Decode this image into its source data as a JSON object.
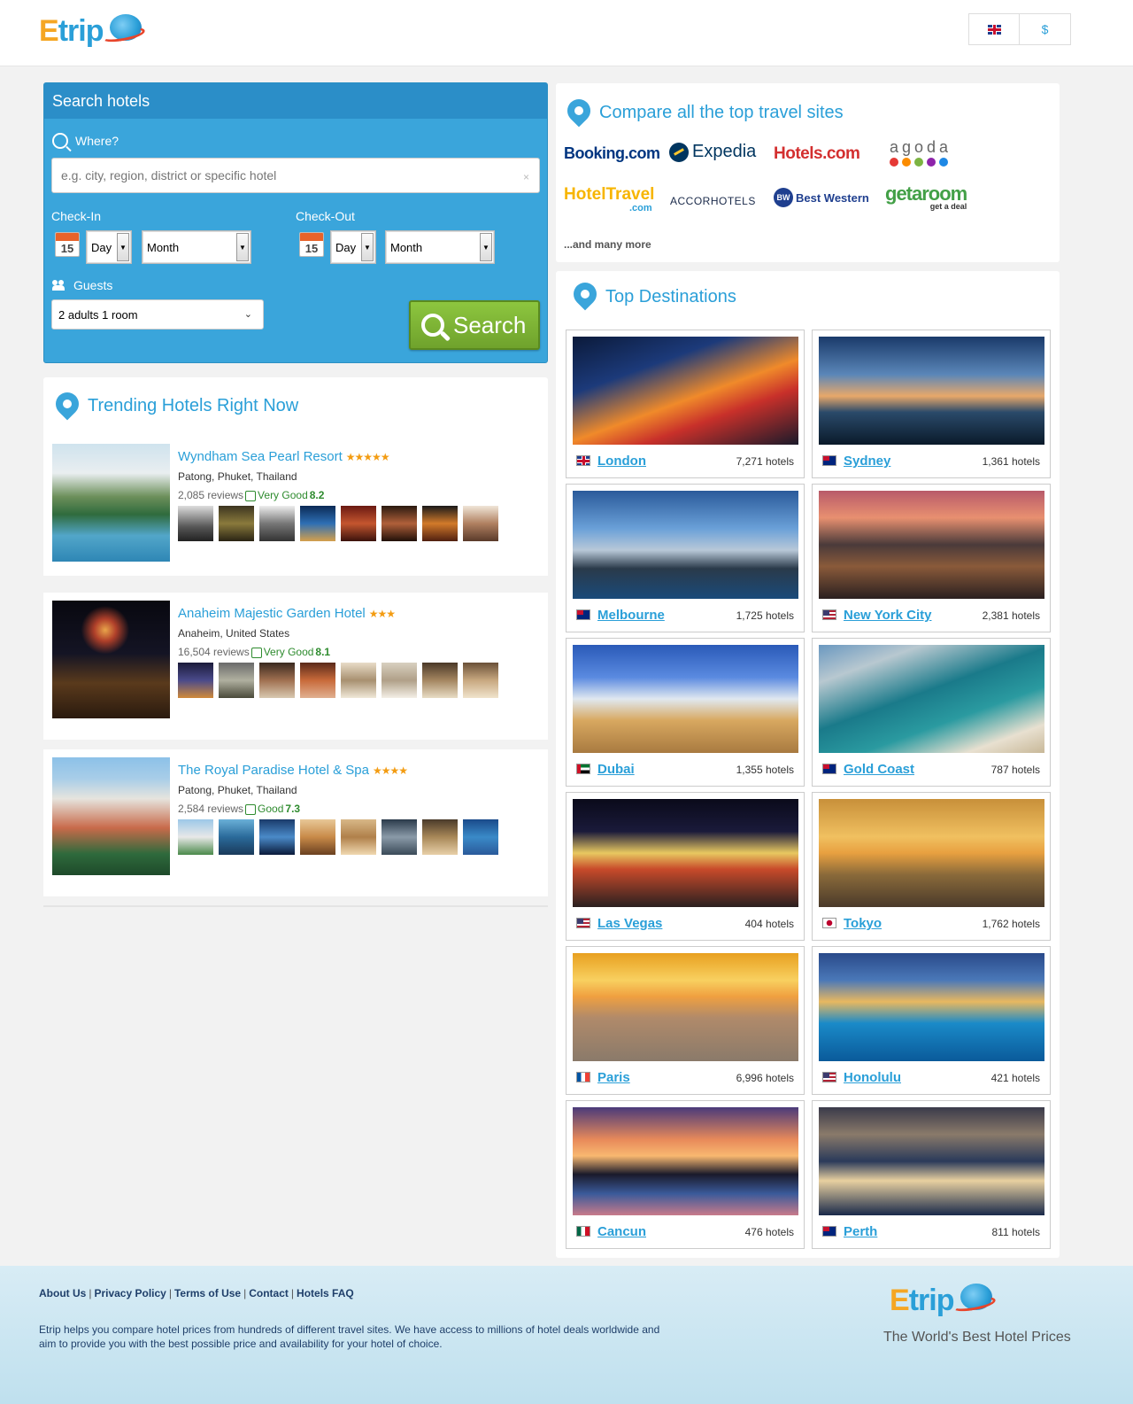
{
  "header": {
    "logo_text_e": "E",
    "logo_text_rest": "trip",
    "language_flag": "uk-flag-icon",
    "currency_label": "$"
  },
  "search": {
    "title": "Search hotels",
    "where_label": "Where?",
    "where_placeholder": "e.g. city, region, district or specific hotel",
    "clear_label": "×",
    "checkin_label": "Check-In",
    "checkout_label": "Check-Out",
    "calendar_day": "15",
    "day_label": "Day",
    "month_label": "Month",
    "guests_label": "Guests",
    "guests_value": "2 adults 1 room",
    "search_button": "Search"
  },
  "trending": {
    "title": "Trending Hotels Right Now",
    "hotels": [
      {
        "name": "Wyndham Sea Pearl Resort",
        "stars": "★★★★★",
        "location": "Patong, Phuket, Thailand",
        "reviews": "2,085 reviews",
        "rating_text": "Very Good",
        "rating_score": "8.2"
      },
      {
        "name": "Anaheim Majestic Garden Hotel",
        "stars": "★★★",
        "location": "Anaheim, United States",
        "reviews": "16,504 reviews",
        "rating_text": "Very Good",
        "rating_score": "8.1"
      },
      {
        "name": "The Royal Paradise Hotel & Spa",
        "stars": "★★★★",
        "location": "Patong, Phuket, Thailand",
        "reviews": "2,584 reviews",
        "rating_text": "Good",
        "rating_score": "7.3"
      }
    ]
  },
  "compare": {
    "title": "Compare all the top travel sites",
    "brands": [
      "Booking.com",
      "Expedia",
      "Hotels.com",
      "agoda",
      "HotelTravel",
      ".com",
      "ACCORHOTELS",
      "Best Western",
      "getaroom",
      "get a deal"
    ],
    "more": "...and many more"
  },
  "destinations": {
    "title": "Top Destinations",
    "items": [
      {
        "city": "London",
        "count": "7,271 hotels",
        "flag": "uk-flag-icon"
      },
      {
        "city": "Sydney",
        "count": "1,361 hotels",
        "flag": "australia-flag-icon"
      },
      {
        "city": "Melbourne",
        "count": "1,725 hotels",
        "flag": "australia-flag-icon"
      },
      {
        "city": "New York City",
        "count": "2,381 hotels",
        "flag": "usa-flag-icon"
      },
      {
        "city": "Dubai",
        "count": "1,355 hotels",
        "flag": "uae-flag-icon"
      },
      {
        "city": "Gold Coast",
        "count": "787 hotels",
        "flag": "australia-flag-icon"
      },
      {
        "city": "Las Vegas",
        "count": "404 hotels",
        "flag": "usa-flag-icon"
      },
      {
        "city": "Tokyo",
        "count": "1,762 hotels",
        "flag": "japan-flag-icon"
      },
      {
        "city": "Paris",
        "count": "6,996 hotels",
        "flag": "france-flag-icon"
      },
      {
        "city": "Honolulu",
        "count": "421 hotels",
        "flag": "usa-flag-icon"
      },
      {
        "city": "Cancun",
        "count": "476 hotels",
        "flag": "mexico-flag-icon"
      },
      {
        "city": "Perth",
        "count": "811 hotels",
        "flag": "australia-flag-icon"
      }
    ]
  },
  "footer": {
    "links": [
      "About Us",
      "Privacy Policy",
      "Terms of Use",
      "Contact",
      "Hotels FAQ"
    ],
    "separator": "|",
    "text": "Etrip helps you compare hotel prices from hundreds of different travel sites. We have access to millions of hotel deals worldwide and aim to provide you with the best possible price and availability for your hotel of choice.",
    "tagline": "The World's Best Hotel Prices"
  }
}
